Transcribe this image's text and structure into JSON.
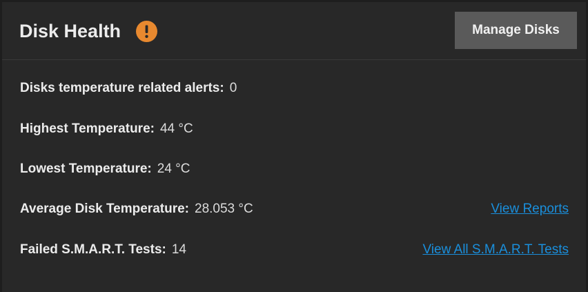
{
  "widget": {
    "title": "Disk Health",
    "warning_icon": "exclamation-circle-icon",
    "warning_color": "#e8892f",
    "manage_button_label": "Manage Disks"
  },
  "stats": {
    "temp_alerts_label": "Disks temperature related alerts:",
    "temp_alerts_value": "0",
    "highest_temp_label": "Highest Temperature:",
    "highest_temp_value": "44 °C",
    "lowest_temp_label": "Lowest Temperature:",
    "lowest_temp_value": "24 °C",
    "avg_temp_label": "Average Disk Temperature:",
    "avg_temp_value": "28.053 °C",
    "failed_smart_label": "Failed S.M.A.R.T. Tests:",
    "failed_smart_value": "14"
  },
  "links": {
    "view_reports": "View Reports",
    "view_all_smart": "View All S.M.A.R.T. Tests"
  },
  "colors": {
    "background": "#282828",
    "link": "#1a8fdc",
    "button": "#5a5a5a"
  }
}
